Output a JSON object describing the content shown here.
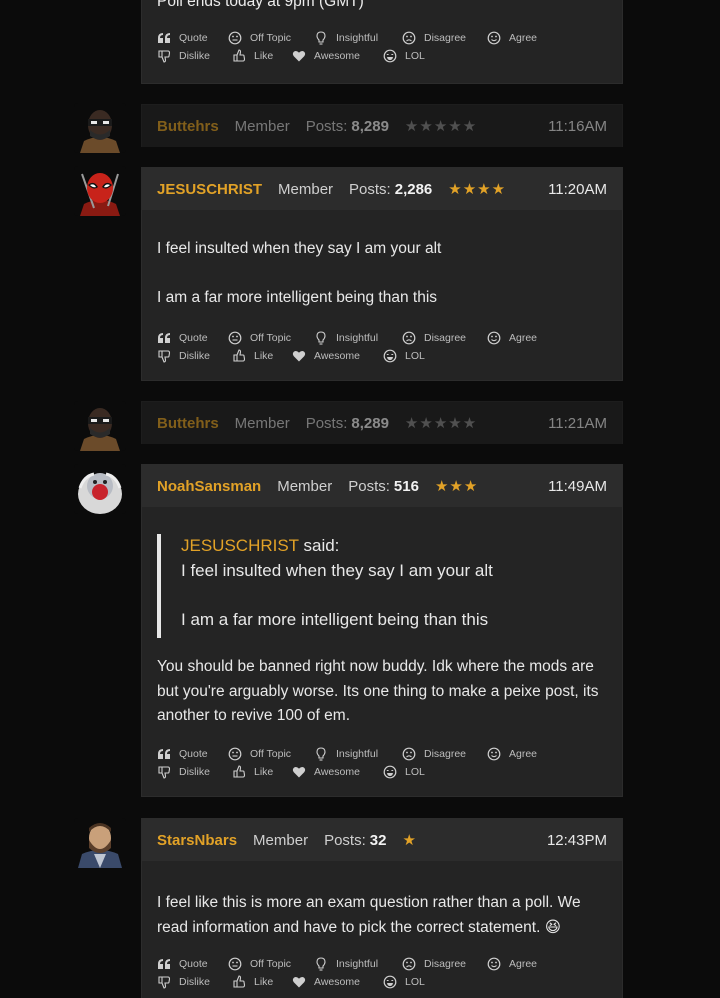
{
  "top_post": {
    "cut_text": "Poll ends today at 9pm (GMT)"
  },
  "reaction_labels": {
    "quote": "Quote",
    "off_topic": "Off Topic",
    "insightful": "Insightful",
    "disagree": "Disagree",
    "agree": "Agree",
    "dislike": "Dislike",
    "like": "Like",
    "awesome": "Awesome",
    "lol": "LOL"
  },
  "posts": [
    {
      "username": "Buttehrs",
      "role": "Member",
      "posts_label": "Posts:",
      "post_count": "8,289",
      "stars_filled": 0,
      "stars_total": 5,
      "time": "11:16AM",
      "collapsed": true,
      "avatar": "masked-soldier-avatar"
    },
    {
      "username": "JESUSCHRIST",
      "role": "Member",
      "posts_label": "Posts:",
      "post_count": "2,286",
      "stars_filled": 4,
      "stars_total": 4,
      "time": "11:20AM",
      "avatar": "deadpool-avatar",
      "body": [
        "I feel insulted when they say I am your alt",
        "I am a far more intelligent being than this"
      ]
    },
    {
      "username": "Buttehrs",
      "role": "Member",
      "posts_label": "Posts:",
      "post_count": "8,289",
      "stars_filled": 0,
      "stars_total": 5,
      "time": "11:21AM",
      "collapsed": true,
      "avatar": "masked-soldier-avatar"
    },
    {
      "username": "NoahSansman",
      "role": "Member",
      "posts_label": "Posts:",
      "post_count": "516",
      "stars_filled": 3,
      "stars_total": 3,
      "time": "11:49AM",
      "avatar": "white-ape-avatar",
      "quote": {
        "author": "JESUSCHRIST",
        "said": "said:",
        "lines": [
          "I feel insulted when they say I am your alt",
          "I am a far more intelligent being than this"
        ]
      },
      "body_text": "You should be banned right now buddy. Idk where the mods are but you're arguably worse. Its one thing to make a peixe post, its another to revive 100 of em."
    },
    {
      "username": "StarsNbars",
      "role": "Member",
      "posts_label": "Posts:",
      "post_count": "32",
      "stars_filled": 1,
      "stars_total": 1,
      "time": "12:43PM",
      "avatar": "bearded-captain-avatar",
      "body_text": "I feel like this is more an exam question rather than a poll. We read information and have to pick the correct statement. 😆"
    }
  ]
}
